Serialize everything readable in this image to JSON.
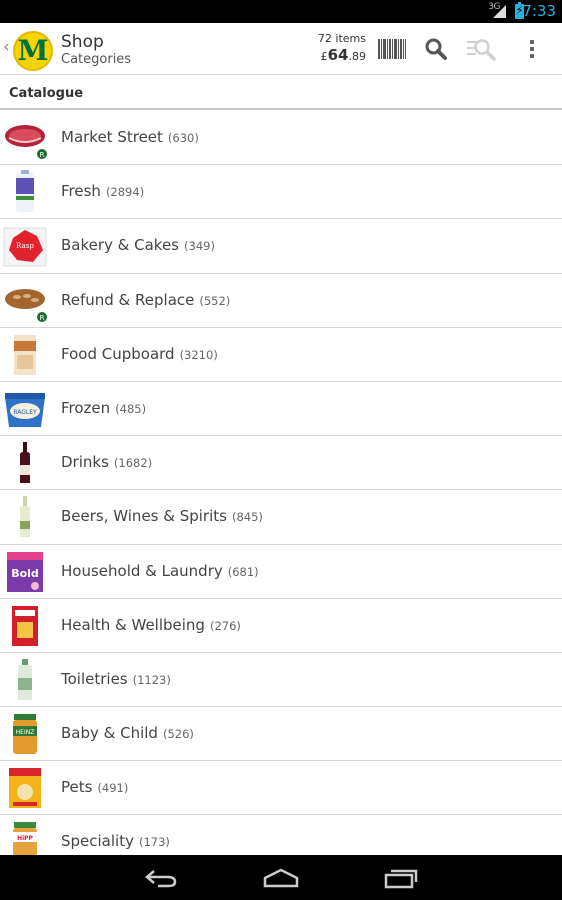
{
  "status_bar": {
    "network": "3G",
    "time": "7:33"
  },
  "header": {
    "title": "Shop",
    "subtitle": "Categories",
    "basket_count": "72 items",
    "basket_currency": "£",
    "basket_pounds": "64",
    "basket_pence": ".89",
    "logo_letter": "M"
  },
  "section": {
    "title": "Catalogue"
  },
  "categories": [
    {
      "name": "Market Street",
      "count": "(630)"
    },
    {
      "name": "Fresh",
      "count": "(2894)"
    },
    {
      "name": "Bakery & Cakes",
      "count": "(349)"
    },
    {
      "name": "Refund & Replace",
      "count": "(552)"
    },
    {
      "name": "Food Cupboard",
      "count": "(3210)"
    },
    {
      "name": "Frozen",
      "count": "(485)"
    },
    {
      "name": "Drinks",
      "count": "(1682)"
    },
    {
      "name": "Beers, Wines & Spirits",
      "count": "(845)"
    },
    {
      "name": "Household & Laundry",
      "count": "(681)"
    },
    {
      "name": "Health & Wellbeing",
      "count": "(276)"
    },
    {
      "name": "Toiletries",
      "count": "(1123)"
    },
    {
      "name": "Baby & Child",
      "count": "(526)"
    },
    {
      "name": "Pets",
      "count": "(491)"
    },
    {
      "name": "Speciality",
      "count": "(173)"
    }
  ],
  "icons": {
    "back": "chevron-left-icon",
    "barcode": "barcode-icon",
    "search": "search-icon",
    "filter": "search-filter-icon",
    "overflow": "overflow-menu-icon",
    "nav_back": "back-icon",
    "nav_home": "home-icon",
    "nav_recents": "recents-icon"
  },
  "colors": {
    "accent": "#2ab0e0",
    "logo": "#f7d400",
    "logo_text": "#00703c"
  }
}
